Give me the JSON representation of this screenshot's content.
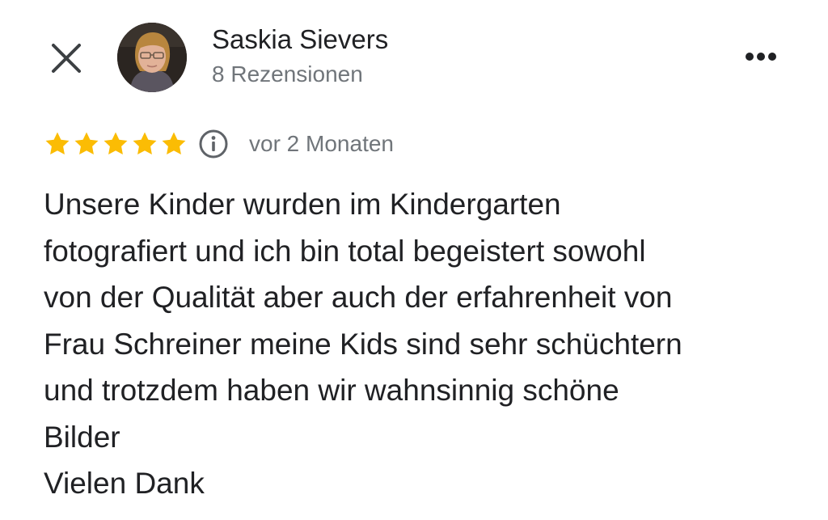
{
  "header": {
    "author_name": "Saskia Sievers",
    "author_meta": "8 Rezensionen"
  },
  "rating": {
    "stars": 5,
    "max_stars": 5,
    "star_color": "#fbbc04",
    "date": "vor 2 Monaten"
  },
  "review": {
    "lines": [
      "Unsere Kinder wurden im Kindergarten",
      "fotografiert und ich bin total begeistert sowohl",
      "von der Qualität aber auch der erfahrenheit von",
      "Frau Schreiner meine Kids sind sehr schüchtern",
      "und trotzdem haben wir wahnsinnig schöne",
      "Bilder",
      "Vielen Dank"
    ]
  },
  "icons": {
    "close": "close-icon",
    "more": "more-options-icon",
    "info": "info-icon",
    "star": "star-icon"
  },
  "colors": {
    "text_primary": "#202124",
    "text_secondary": "#70757a",
    "star": "#fbbc04",
    "background": "#ffffff"
  }
}
